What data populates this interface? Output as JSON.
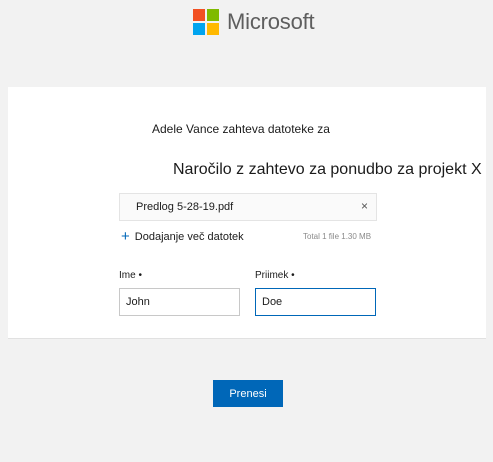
{
  "brand": {
    "name": "Microsoft",
    "logo_colors": [
      "#f25022",
      "#7fba00",
      "#00a4ef",
      "#ffb900"
    ]
  },
  "request": {
    "requester_line": "Adele Vance zahteva datoteke za",
    "title": "Naročilo z zahtevo za ponudbo za projekt X"
  },
  "file": {
    "name": "Predlog 5-28-19.pdf",
    "remove_icon": "close-icon",
    "remove_glyph": "×"
  },
  "add_files": {
    "icon": "plus-icon",
    "glyph": "+",
    "label": "Dodajanje več datotek"
  },
  "total": "Total 1 file  1.30 MB",
  "form": {
    "first_name_label": "Ime •",
    "first_name_value": "John",
    "last_name_label": "Priimek •",
    "last_name_value": "Doe"
  },
  "upload_label": "Prenesi",
  "colors": {
    "accent": "#0067b8",
    "page_bg": "#f2f2f2"
  }
}
